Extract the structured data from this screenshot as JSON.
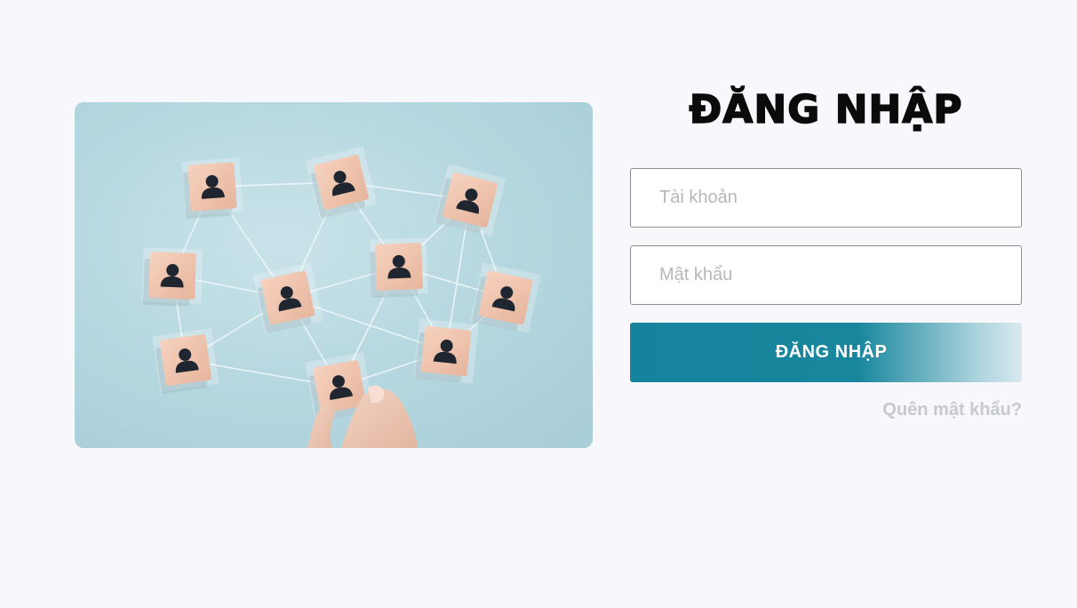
{
  "login": {
    "title": "ĐĂNG NHẬP",
    "username_placeholder": "Tài khoản",
    "password_placeholder": "Mật khẩu",
    "submit_label": "ĐĂNG NHẬP",
    "forgot_label": "Quên mật khẩu?"
  },
  "colors": {
    "page_background": "#f7f7fc",
    "button_primary": "#15839b",
    "forgot_link": "#c7c9d0",
    "field_border": "#8e8e8e"
  },
  "hero": {
    "icon": "network-people-cubes-icon"
  }
}
